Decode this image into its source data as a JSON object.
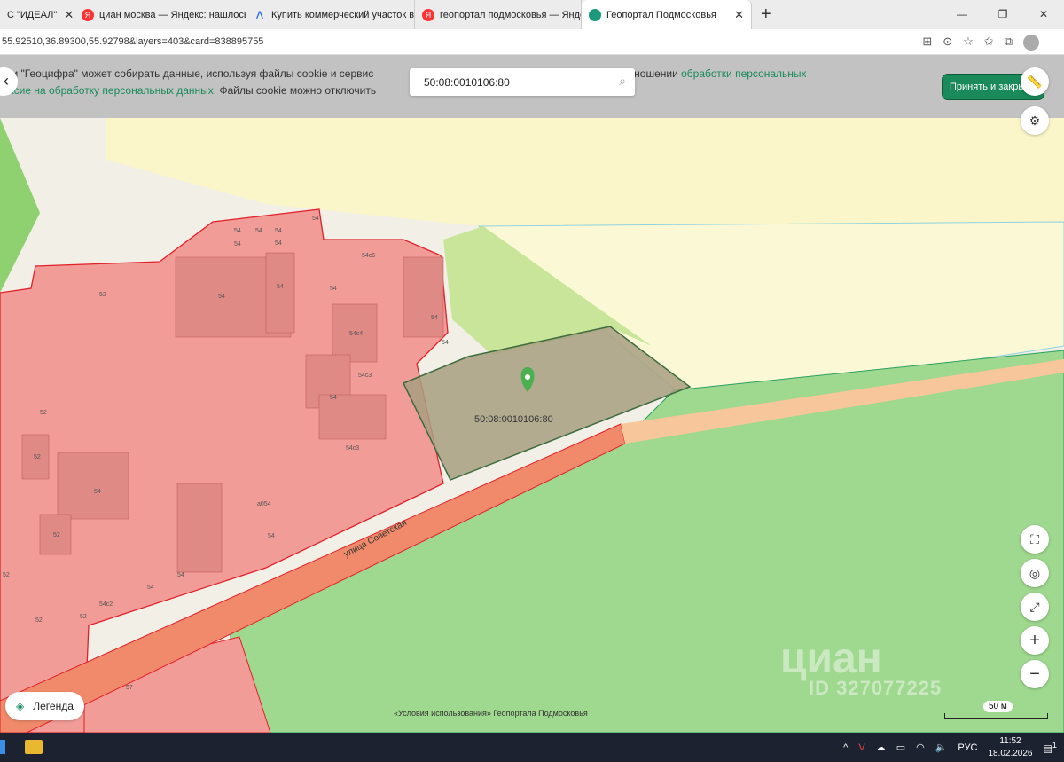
{
  "browser": {
    "tabs": [
      {
        "title": "С \"ИДЕАЛ\"",
        "icon": "none",
        "active": false
      },
      {
        "title": "циан москва — Яндекс: нашлось",
        "icon": "yandex-icon",
        "active": false
      },
      {
        "title": "Купить коммерческий участок в",
        "icon": "cian-icon",
        "active": false
      },
      {
        "title": "геопортал подмосковья — Яндекс",
        "icon": "yandex-icon",
        "active": false
      },
      {
        "title": "Геопортал Подмосковья",
        "icon": "geoportal-icon",
        "active": true
      }
    ],
    "url": "55.92510,36.89300,55.92798&layers=403&card=838895755"
  },
  "cookie_banner": {
    "line1_text": "сти \"Геоцифра\" может собирать данные, используя файлы cookie и сервис",
    "line1_tail": "итике в отношении ",
    "line1_link": "обработки персональных",
    "line2_link": "ласие на обработку персональных данных.",
    "line2_text": " Файлы cookie можно отключить",
    "accept_label": "Принять и закрыть"
  },
  "search": {
    "value": "50:08:0010106:80"
  },
  "map": {
    "selected_parcel_label": "50:08:0010106:80",
    "street_label": "улица Советская",
    "building_labels": [
      "54",
      "54",
      "54",
      "54",
      "54",
      "54",
      "54c5",
      "52",
      "54",
      "54",
      "54",
      "54c4",
      "54",
      "54",
      "54c3",
      "54",
      "54c3",
      "52",
      "52",
      "54",
      "52",
      "a054",
      "54",
      "52",
      "54",
      "54c2",
      "54",
      "52",
      "52",
      "57"
    ],
    "legend_label": "Легенда",
    "terms": "«Условия использования» Геопортала Подмосковья",
    "scale_label": "50 м",
    "watermark": "циан",
    "watermark_id": "ID 327077225",
    "colors": {
      "parcel_red": "#f29c97",
      "border_red": "#e0202a",
      "selected": "#a89f80",
      "green": "#9fd88f",
      "yellow": "#fbf6c9",
      "road": "#f08a6a"
    }
  },
  "taskbar": {
    "lang": "РУС",
    "time": "11:52",
    "date": "18.02.2026",
    "notifications": "1"
  }
}
